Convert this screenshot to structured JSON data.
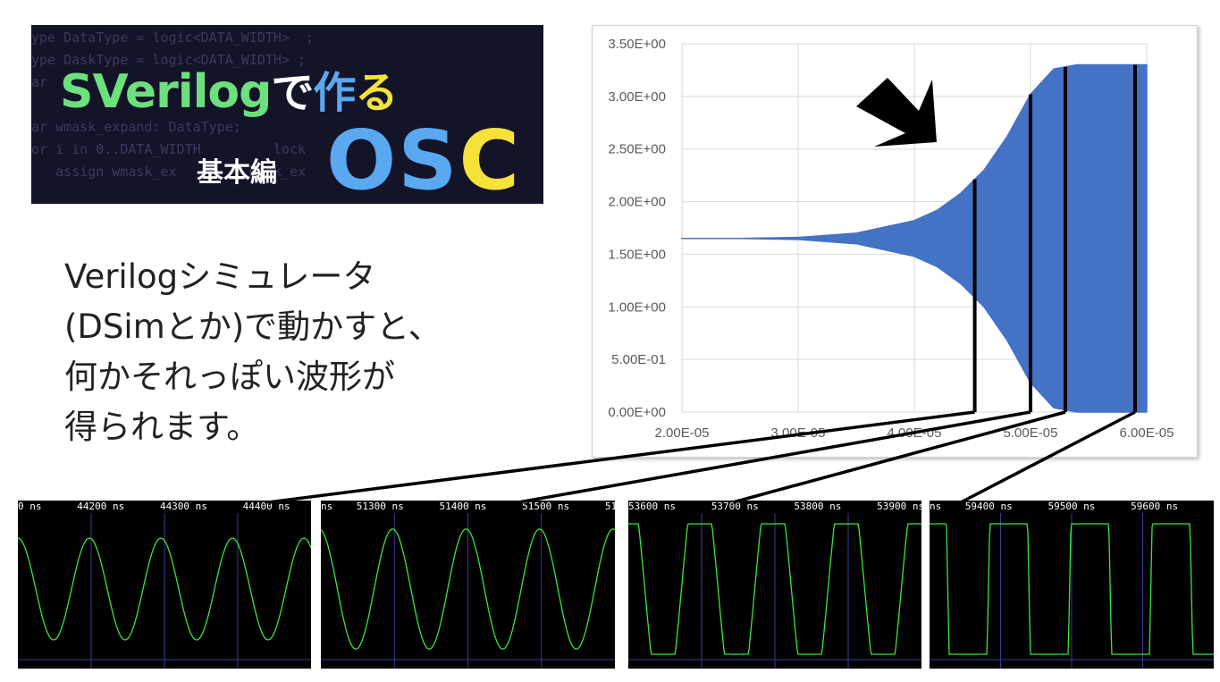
{
  "banner": {
    "title_sv": "SVerilog",
    "title_jp": "で作る",
    "subtitle": "基本編",
    "osc": "OSC",
    "code_lines": [
      "ype DataType = logic<DATA_WIDTH>  ;",
      "ype DaskType = logic<DATA_WIDTH> ;",
      "ar    ",
      "",
      "ar wmask_expand: DataType;",
      "or i in 0..DATA_WIDTH         lock",
      "   assign wmask_ex         mask_ex"
    ]
  },
  "description": {
    "line1": "Verilogシミュレータ",
    "line2": "(DSimとか)で動かすと、",
    "line3": "何かそれっぽい波形が",
    "line4": "得られます。"
  },
  "colors": {
    "waveform_fill": "#4472c4",
    "scope_trace": "#39e639",
    "scope_grid": "#3b3b9a",
    "banner_green": "#6de07e",
    "banner_blue": "#5aa8f0",
    "banner_yellow": "#f5e33a"
  },
  "chart_data": {
    "type": "area",
    "title": "",
    "xlabel": "",
    "ylabel": "",
    "xlim": [
      2e-05,
      6e-05
    ],
    "ylim": [
      0,
      3.5
    ],
    "x_tick_labels": [
      "2.00E-05",
      "3.00E-05",
      "4.00E-05",
      "5.00E-05",
      "6.00E-05"
    ],
    "y_tick_labels": [
      "0.00E+00",
      "5.00E-01",
      "1.00E+00",
      "1.50E+00",
      "2.00E+00",
      "2.50E+00",
      "3.00E+00",
      "3.50E+00"
    ],
    "grid": true,
    "series": [
      {
        "x": [
          2e-05,
          2.5e-05,
          3e-05,
          3.5e-05,
          4e-05,
          4.2e-05,
          4.4e-05,
          4.6e-05,
          4.8e-05,
          5e-05,
          5.2e-05,
          5.4e-05,
          5.6e-05,
          6e-05
        ],
        "upper": [
          1.65,
          1.65,
          1.66,
          1.7,
          1.82,
          1.92,
          2.08,
          2.3,
          2.62,
          3.02,
          3.26,
          3.3,
          3.3,
          3.3
        ],
        "lower": [
          1.65,
          1.65,
          1.64,
          1.6,
          1.48,
          1.38,
          1.22,
          1.0,
          0.68,
          0.28,
          0.04,
          0.0,
          0.0,
          0.0
        ]
      }
    ],
    "markers_x": [
      4.52e-05,
      5e-05,
      5.3e-05,
      5.9e-05
    ]
  },
  "scopes": [
    {
      "header": "0 ns      44200 ns      44300 ns      44400 ns      44",
      "waveform": "sine",
      "cycles": 4.1,
      "amplitude": 0.78
    },
    {
      "header": "ns    51300 ns      51400 ns      51500 ns      516",
      "waveform": "sine",
      "cycles": 4.0,
      "amplitude": 0.92
    },
    {
      "header": "53600 ns      53700 ns      53800 ns      53900 ns",
      "waveform": "clipped",
      "cycles": 4.0,
      "amplitude": 1.0
    },
    {
      "header": "ns    59400 ns      59500 ns      59600 ns      5970",
      "waveform": "square",
      "cycles": 3.5,
      "amplitude": 1.0
    }
  ]
}
